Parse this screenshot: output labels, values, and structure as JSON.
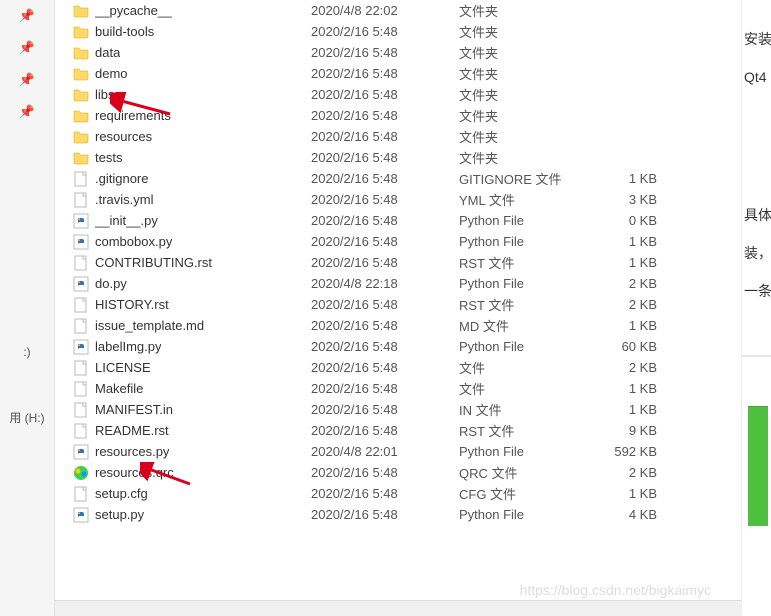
{
  "sidebar": {
    "pins": [
      "📌",
      "📌",
      "📌",
      "📌"
    ],
    "label1": ":)",
    "label2": "用 (H:)"
  },
  "files": [
    {
      "icon": "folder",
      "name": "__pycache__",
      "date": "2020/4/8 22:02",
      "type": "文件夹",
      "size": ""
    },
    {
      "icon": "folder",
      "name": "build-tools",
      "date": "2020/2/16 5:48",
      "type": "文件夹",
      "size": ""
    },
    {
      "icon": "folder",
      "name": "data",
      "date": "2020/2/16 5:48",
      "type": "文件夹",
      "size": ""
    },
    {
      "icon": "folder",
      "name": "demo",
      "date": "2020/2/16 5:48",
      "type": "文件夹",
      "size": ""
    },
    {
      "icon": "folder",
      "name": "libs",
      "date": "2020/2/16 5:48",
      "type": "文件夹",
      "size": ""
    },
    {
      "icon": "folder",
      "name": "requirements",
      "date": "2020/2/16 5:48",
      "type": "文件夹",
      "size": ""
    },
    {
      "icon": "folder",
      "name": "resources",
      "date": "2020/2/16 5:48",
      "type": "文件夹",
      "size": ""
    },
    {
      "icon": "folder",
      "name": "tests",
      "date": "2020/2/16 5:48",
      "type": "文件夹",
      "size": ""
    },
    {
      "icon": "file",
      "name": ".gitignore",
      "date": "2020/2/16 5:48",
      "type": "GITIGNORE 文件",
      "size": "1 KB"
    },
    {
      "icon": "file",
      "name": ".travis.yml",
      "date": "2020/2/16 5:48",
      "type": "YML 文件",
      "size": "3 KB"
    },
    {
      "icon": "py",
      "name": "__init__.py",
      "date": "2020/2/16 5:48",
      "type": "Python File",
      "size": "0 KB"
    },
    {
      "icon": "py",
      "name": "combobox.py",
      "date": "2020/2/16 5:48",
      "type": "Python File",
      "size": "1 KB"
    },
    {
      "icon": "file",
      "name": "CONTRIBUTING.rst",
      "date": "2020/2/16 5:48",
      "type": "RST 文件",
      "size": "1 KB"
    },
    {
      "icon": "py",
      "name": "do.py",
      "date": "2020/4/8 22:18",
      "type": "Python File",
      "size": "2 KB"
    },
    {
      "icon": "file",
      "name": "HISTORY.rst",
      "date": "2020/2/16 5:48",
      "type": "RST 文件",
      "size": "2 KB"
    },
    {
      "icon": "file",
      "name": "issue_template.md",
      "date": "2020/2/16 5:48",
      "type": "MD 文件",
      "size": "1 KB"
    },
    {
      "icon": "py",
      "name": "labelImg.py",
      "date": "2020/2/16 5:48",
      "type": "Python File",
      "size": "60 KB"
    },
    {
      "icon": "file",
      "name": "LICENSE",
      "date": "2020/2/16 5:48",
      "type": "文件",
      "size": "2 KB"
    },
    {
      "icon": "file",
      "name": "Makefile",
      "date": "2020/2/16 5:48",
      "type": "文件",
      "size": "1 KB"
    },
    {
      "icon": "file",
      "name": "MANIFEST.in",
      "date": "2020/2/16 5:48",
      "type": "IN 文件",
      "size": "1 KB"
    },
    {
      "icon": "file",
      "name": "README.rst",
      "date": "2020/2/16 5:48",
      "type": "RST 文件",
      "size": "9 KB"
    },
    {
      "icon": "py",
      "name": "resources.py",
      "date": "2020/4/8 22:01",
      "type": "Python File",
      "size": "592 KB"
    },
    {
      "icon": "qrc",
      "name": "resources.qrc",
      "date": "2020/2/16 5:48",
      "type": "QRC 文件",
      "size": "2 KB"
    },
    {
      "icon": "file",
      "name": "setup.cfg",
      "date": "2020/2/16 5:48",
      "type": "CFG 文件",
      "size": "1 KB"
    },
    {
      "icon": "py",
      "name": "setup.py",
      "date": "2020/2/16 5:48",
      "type": "Python File",
      "size": "4 KB"
    }
  ],
  "rightpanel": {
    "line1": "安装",
    "line2": "Qt4",
    "line3": "具体",
    "line4": "装，",
    "line5": "一条"
  },
  "watermark": "https://blog.csdn.net/bigkaimyc"
}
